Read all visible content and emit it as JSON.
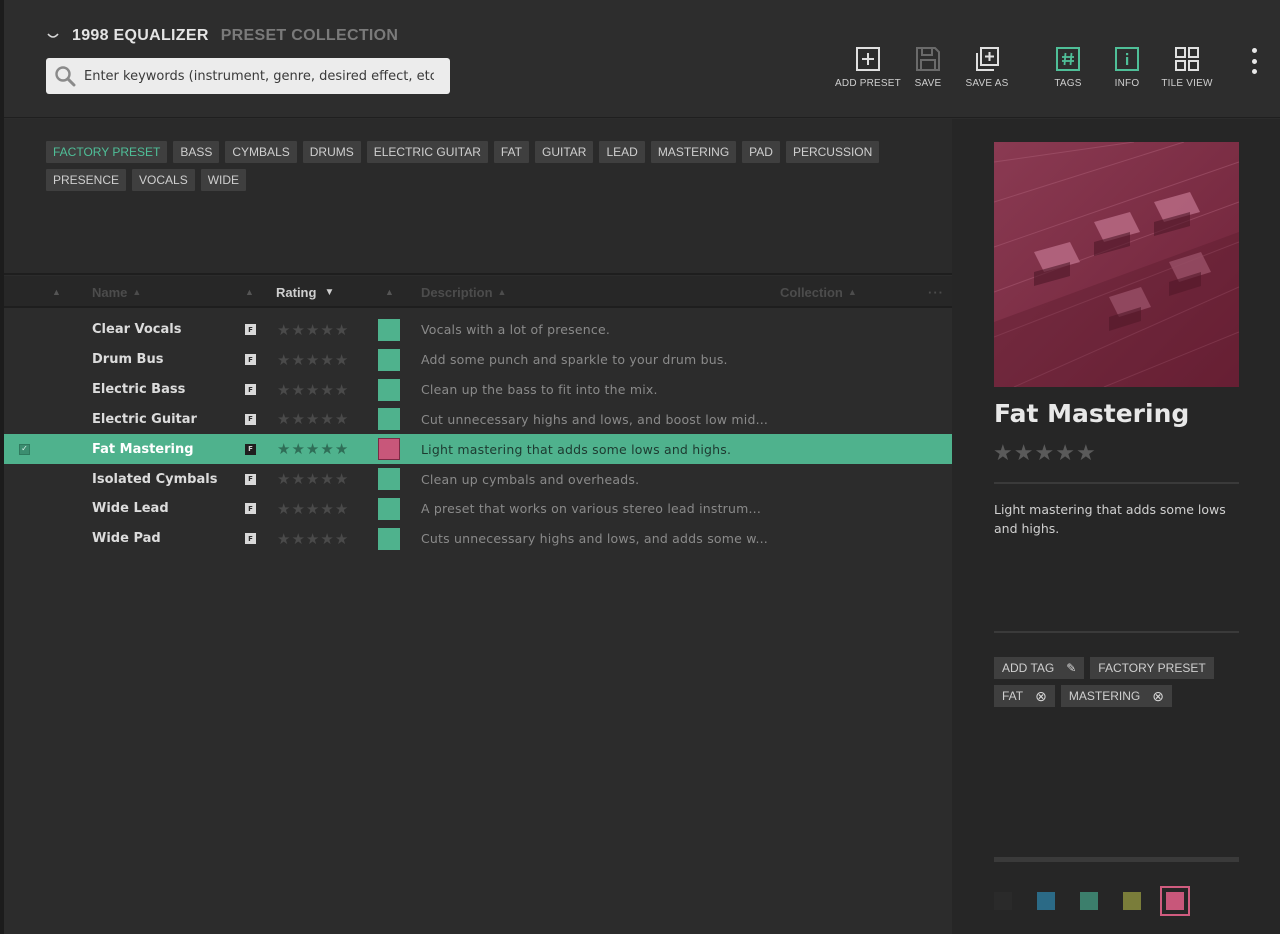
{
  "app": {
    "title": "1998 EQUALIZER",
    "subtitle": "PRESET COLLECTION"
  },
  "search": {
    "placeholder": "Enter keywords (instrument, genre, desired effect, etc.)",
    "value": ""
  },
  "toolbar": {
    "add_preset": "ADD PRESET",
    "save": "SAVE",
    "save_as": "SAVE AS",
    "tags": "TAGS",
    "info": "INFO",
    "tile_view": "TILE VIEW"
  },
  "tags": [
    {
      "label": "FACTORY PRESET",
      "active": true
    },
    {
      "label": "BASS",
      "active": false
    },
    {
      "label": "CYMBALS",
      "active": false
    },
    {
      "label": "DRUMS",
      "active": false
    },
    {
      "label": "ELECTRIC GUITAR",
      "active": false
    },
    {
      "label": "FAT",
      "active": false
    },
    {
      "label": "GUITAR",
      "active": false
    },
    {
      "label": "LEAD",
      "active": false
    },
    {
      "label": "MASTERING",
      "active": false
    },
    {
      "label": "PAD",
      "active": false
    },
    {
      "label": "PERCUSSION",
      "active": false
    },
    {
      "label": "PRESENCE",
      "active": false
    },
    {
      "label": "VOCALS",
      "active": false
    },
    {
      "label": "WIDE",
      "active": false
    }
  ],
  "table": {
    "columns": {
      "name": "Name",
      "rating": "Rating",
      "description": "Description",
      "collection": "Collection",
      "more": "···"
    },
    "rows": [
      {
        "name": "Clear Vocals",
        "factory": "F",
        "rating": 0,
        "color": "#4fb28d",
        "description": "Vocals with a lot of presence.",
        "selected": false
      },
      {
        "name": "Drum Bus",
        "factory": "F",
        "rating": 0,
        "color": "#4fb28d",
        "description": "Add some punch and sparkle to your drum bus.",
        "selected": false
      },
      {
        "name": "Electric Bass",
        "factory": "F",
        "rating": 0,
        "color": "#4fb28d",
        "description": "Clean up the bass to fit into the mix.",
        "selected": false
      },
      {
        "name": "Electric Guitar",
        "factory": "F",
        "rating": 0,
        "color": "#4fb28d",
        "description": "Cut unnecessary highs and lows, and boost low mid...",
        "selected": false
      },
      {
        "name": "Fat Mastering",
        "factory": "F",
        "rating": 0,
        "color": "#c8577a",
        "description": "Light mastering that adds some lows and highs.",
        "selected": true
      },
      {
        "name": "Isolated Cymbals",
        "factory": "F",
        "rating": 0,
        "color": "#4fb28d",
        "description": "Clean up cymbals and overheads.",
        "selected": false
      },
      {
        "name": "Wide Lead",
        "factory": "F",
        "rating": 0,
        "color": "#4fb28d",
        "description": "A preset that works on various stereo lead instrum...",
        "selected": false
      },
      {
        "name": "Wide Pad",
        "factory": "F",
        "rating": 0,
        "color": "#4fb28d",
        "description": "Cuts unnecessary highs and lows, and adds some w...",
        "selected": false
      }
    ]
  },
  "detail": {
    "title": "Fat Mastering",
    "rating": 0,
    "description": "Light mastering that adds some lows and highs.",
    "add_tag": "ADD TAG",
    "tags": [
      "FACTORY PRESET",
      "FAT",
      "MASTERING"
    ],
    "colors": [
      "#2a2a2a",
      "#2b6a86",
      "#3c7f6c",
      "#7a7d3a",
      "#c8577a"
    ],
    "selected_color": 4
  },
  "theme": {
    "accent": "#4fb28d",
    "accent_text": "#4fbf98",
    "selected_swatch": "#c8577a"
  }
}
